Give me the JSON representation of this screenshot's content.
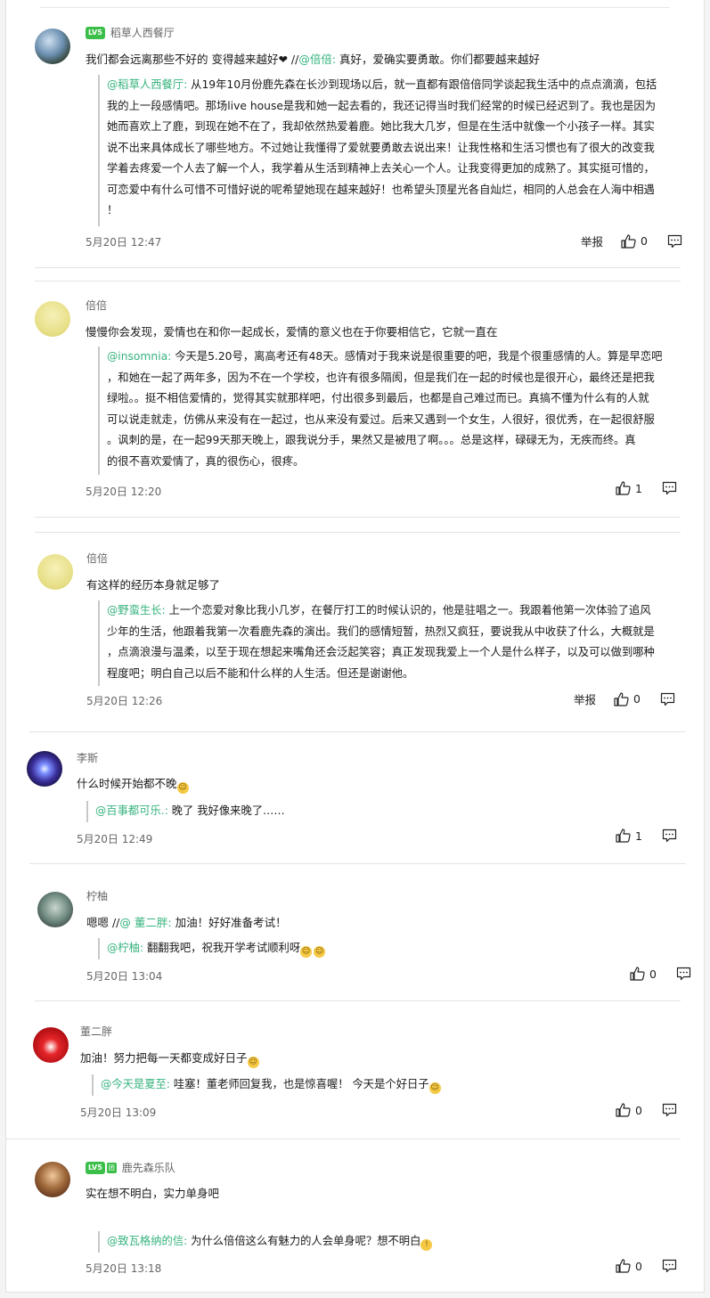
{
  "comments": [
    {
      "name": "稻草人西餐厅",
      "level_badge": "LV5",
      "text_pre": "我们都会远离那些不好的 变得越来越好❤ //",
      "text_mention": "@倍倍:",
      "text_post": " 真好，爱确实要勇敢。你们都要越来越好",
      "quote_mention": "@稻草人西餐厅:",
      "quote_lines": [
        " 从19年10月份鹿先森在长沙到现场以后，就一直都有跟倍倍同学谈起我生活中的点点滴滴，包括",
        "我的上一段感情吧。那场live house是我和她一起去看的，我还记得当时我们经常的时候已经迟到了。我也是因为",
        "她而喜欢上了鹿，到现在她不在了，我却依然热爱着鹿。她比我大几岁，但是在生活中就像一个小孩子一样。其实",
        "说不出来具体成长了哪些地方。不过她让我懂得了爱就要勇敢去说出来！让我性格和生活习惯也有了很大的改变我",
        "学着去疼爱一个人去了解一个人，我学着从生活到精神上去关心一个人。让我变得更加的成熟了。其实挺可惜的，",
        "可恋爱中有什么可惜不可惜好说的呢希望她现在越来越好！也希望头顶星光各自灿烂，相同的人总会在人海中相遇",
        "！"
      ],
      "time": "5月20日 12:47",
      "report": "举报",
      "likes": "0"
    },
    {
      "name": "倍倍",
      "text": "慢慢你会发现，爱情也在和你一起成长，爱情的意义也在于你要相信它，它就一直在",
      "quote_mention": "@insomnia:",
      "quote_lines": [
        " 今天是5.20号，离高考还有48天。感情对于我来说是很重要的吧，我是个很重感情的人。算是早恋吧",
        "，和她在一起了两年多，因为不在一个学校，也许有很多隔阂，但是我们在一起的时候也是很开心，最终还是把我",
        "绿啦。。挺不相信爱情的，觉得其实就那样吧，付出很多到最后，也都是自己难过而已。真搞不懂为什么有的人就",
        "可以说走就走，仿佛从来没有在一起过，也从来没有爱过。后来又遇到一个女生，人很好，很优秀，在一起很舒服",
        "。讽刺的是，在一起99天那天晚上，跟我说分手，果然又是被甩了啊。。。总是这样，碌碌无为，无疾而终。真",
        "的很不喜欢爱情了，真的很伤心，很疼。"
      ],
      "time": "5月20日 12:20",
      "likes": "1"
    },
    {
      "name": "倍倍",
      "text": "有这样的经历本身就足够了",
      "quote_mention": "@野蛮生长:",
      "quote_lines": [
        " 上一个恋爱对象比我小几岁，在餐厅打工的时候认识的，他是驻唱之一。我跟着他第一次体验了追风",
        "少年的生活，他跟着我第一次看鹿先森的演出。我们的感情短暂，热烈又疯狂，要说我从中收获了什么，大概就是",
        "，点滴浪漫与温柔，以至于现在想起来嘴角还会泛起笑容；真正发现我爱上一个人是什么样子，以及可以做到哪种",
        "程度吧；明白自己以后不能和什么样的人生活。但还是谢谢他。"
      ],
      "time": "5月20日 12:26",
      "report": "举报",
      "likes": "0"
    },
    {
      "name": "李斯",
      "text": "什么时候开始都不晚",
      "quote_mention": "@百事都可乐.:",
      "quote_text": " 晚了 我好像来晚了……",
      "time": "5月20日 12:49",
      "likes": "1"
    },
    {
      "name": "柠柚",
      "text_pre": "嗯嗯 //",
      "text_mention": "@ 董二胖:",
      "text_post": " 加油！好好准备考试！",
      "quote_mention": "@柠柚:",
      "quote_text": " 翻翻我吧，祝我开学考试顺利呀",
      "time": "5月20日 13:04",
      "likes": "0"
    },
    {
      "name": "董二胖",
      "text": "加油！努力把每一天都变成好日子",
      "quote_mention": "@今天是夏至:",
      "quote_text": " 哇塞！董老师回复我，也是惊喜喔！ 今天是个好日子",
      "time": "5月20日 13:09",
      "likes": "0"
    },
    {
      "name": "鹿先森乐队",
      "level_badge": "LV5",
      "sub_badge": "团",
      "text": "实在想不明白，实力单身吧",
      "quote_mention": "@致瓦格纳的信:",
      "quote_text": " 为什么倍倍这么有魅力的人会单身呢？想不明白",
      "time": "5月20日 13:18",
      "likes": "0"
    }
  ],
  "colors": {
    "mention": "#36b37e",
    "badge": "#3cbf4a"
  }
}
